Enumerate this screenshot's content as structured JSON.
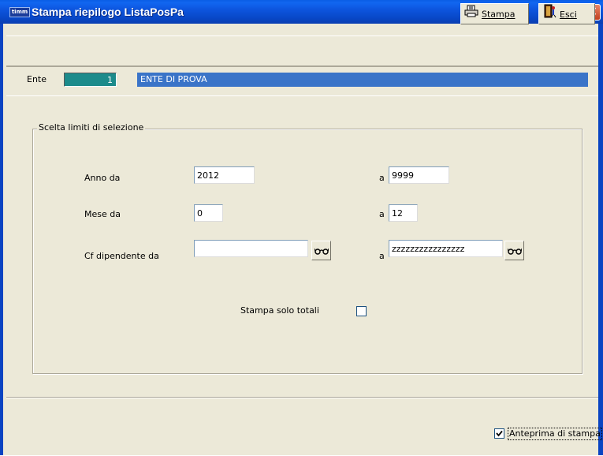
{
  "window": {
    "title": "Stampa riepilogo ListaPosPa",
    "app_icon_text": "timm"
  },
  "toolbar": {
    "stampa_label": "Stampa",
    "esci_label": "Esci"
  },
  "ente": {
    "label": "Ente",
    "code": "1",
    "name": "ENTE DI PROVA"
  },
  "selection": {
    "group_title": "Scelta limiti di selezione",
    "anno_label": "Anno da",
    "anno_da": "2012",
    "anno_a": "9999",
    "mese_label": "Mese da",
    "mese_da": "0",
    "mese_a": "12",
    "cf_label": "Cf dipendente da",
    "cf_da": "",
    "cf_a": "zzzzzzzzzzzzzzzz",
    "a_label": "a",
    "solo_totali_label": "Stampa solo totali",
    "solo_totali_checked": false
  },
  "footer": {
    "anteprima_label": "Anteprima di stampa",
    "anteprima_checked": true
  }
}
